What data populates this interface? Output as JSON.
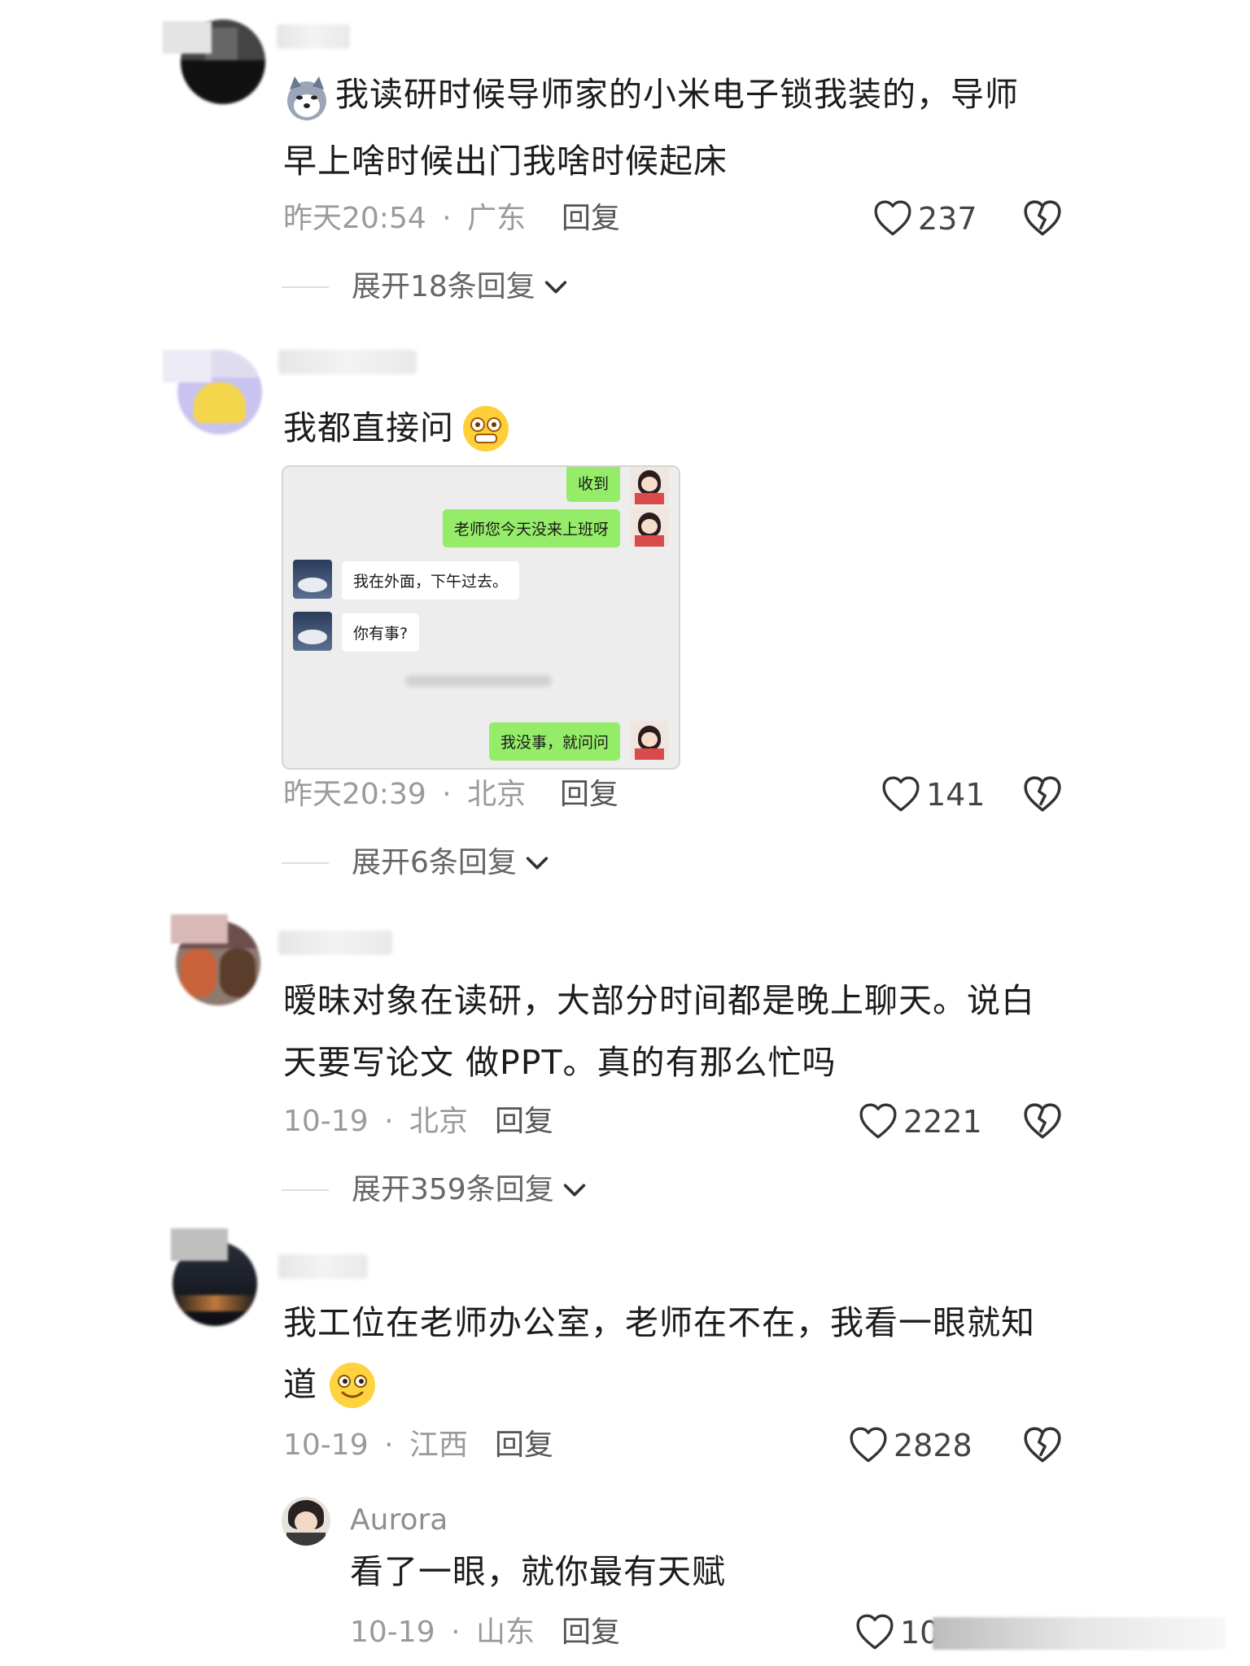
{
  "comments": [
    {
      "text_line1": "我读研时候导师家的小米电子锁我装的，导师",
      "text_line2": "早上啥时候出门我啥时候起床",
      "time": "昨天20:54",
      "location": "广东",
      "reply_label": "回复",
      "likes": "237",
      "expand": "展开18条回复"
    },
    {
      "text_line1": "我都直接问",
      "time": "昨天20:39",
      "location": "北京",
      "reply_label": "回复",
      "likes": "141",
      "expand": "展开6条回复",
      "chat": {
        "msg1": "收到",
        "msg2": "老师您今天没来上班呀",
        "msg3": "我在外面，下午过去。",
        "msg4": "你有事?",
        "msg5": "我没事，就问问"
      }
    },
    {
      "text_line1": "暧昧对象在读研，大部分时间都是晚上聊天。说白",
      "text_line2": "天要写论文 做PPT。真的有那么忙吗",
      "time": "10-19",
      "location": "北京",
      "reply_label": "回复",
      "likes": "2221",
      "expand": "展开359条回复"
    },
    {
      "text_line1": "我工位在老师办公室，老师在不在，我看一眼就知",
      "text_line2": "道",
      "time": "10-19",
      "location": "江西",
      "reply_label": "回复",
      "likes": "2828"
    }
  ],
  "sub_reply": {
    "username": "Aurora",
    "text": "看了一眼，就你最有天赋",
    "time": "10-19",
    "location": "山东",
    "reply_label": "回复",
    "likes": "10"
  },
  "separator": "·",
  "colors": {
    "like_icon": "#333333",
    "meta_text": "#9a9a9a",
    "chat_green": "#95ec69"
  },
  "icons": [
    "heart-icon",
    "dislike-heart-icon",
    "chevron-down-icon"
  ]
}
